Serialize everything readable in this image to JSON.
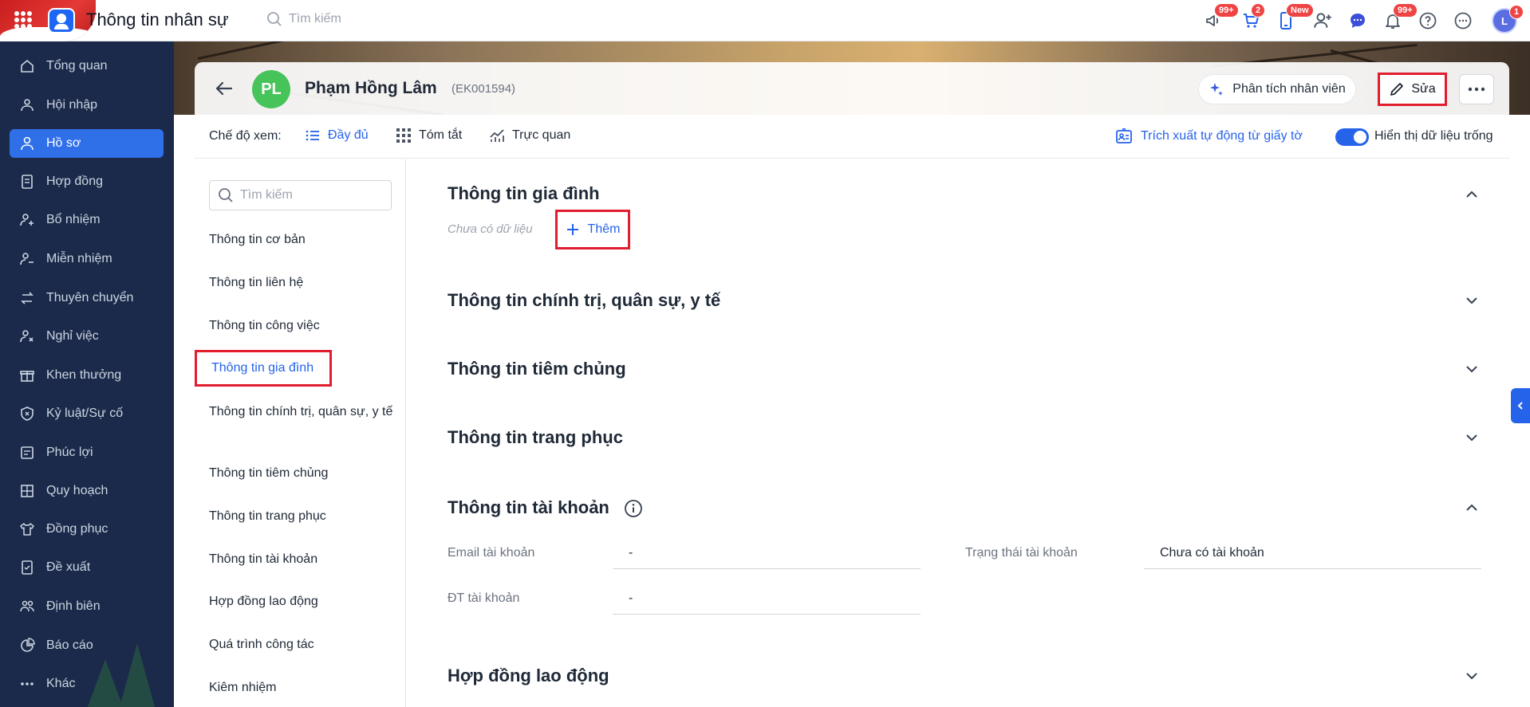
{
  "app": {
    "title": "Thông tin nhân sự",
    "search_placeholder": "Tìm kiếm"
  },
  "top_icons": [
    {
      "icon": "megaphone-icon",
      "badge": "99+"
    },
    {
      "icon": "cart-icon",
      "badge": "2"
    },
    {
      "icon": "phone-icon",
      "badge": "New"
    },
    {
      "icon": "add-user-icon",
      "badge": ""
    },
    {
      "icon": "chat-icon",
      "badge": ""
    },
    {
      "icon": "bell-icon",
      "badge": "99+"
    },
    {
      "icon": "help-icon",
      "badge": ""
    },
    {
      "icon": "more-circle-icon",
      "badge": ""
    }
  ],
  "user": {
    "initials": "L",
    "badge": "1"
  },
  "sidebar": {
    "items": [
      {
        "label": "Tổng quan",
        "icon": "home-icon"
      },
      {
        "label": "Hội nhập",
        "icon": "onboard-icon"
      },
      {
        "label": "Hồ sơ",
        "icon": "profile-icon",
        "active": true
      },
      {
        "label": "Hợp đồng",
        "icon": "contract-icon"
      },
      {
        "label": "Bổ nhiệm",
        "icon": "appoint-icon"
      },
      {
        "label": "Miễn nhiệm",
        "icon": "dismiss-icon"
      },
      {
        "label": "Thuyên chuyển",
        "icon": "transfer-icon"
      },
      {
        "label": "Nghỉ việc",
        "icon": "resign-icon"
      },
      {
        "label": "Khen thưởng",
        "icon": "reward-icon"
      },
      {
        "label": "Kỷ luật/Sự cố",
        "icon": "discipline-icon"
      },
      {
        "label": "Phúc lợi",
        "icon": "benefit-icon"
      },
      {
        "label": "Quy hoạch",
        "icon": "plan-icon"
      },
      {
        "label": "Đồng phục",
        "icon": "uniform-icon"
      },
      {
        "label": "Đề xuất",
        "icon": "propose-icon"
      },
      {
        "label": "Định biên",
        "icon": "headcount-icon"
      },
      {
        "label": "Báo cáo",
        "icon": "report-icon"
      },
      {
        "label": "Khác",
        "icon": "other-icon"
      }
    ]
  },
  "employee": {
    "initials": "PL",
    "name": "Phạm Hồng Lâm",
    "code": "(EK001594)",
    "analyze_label": "Phân tích nhân viên",
    "edit_label": "Sửa"
  },
  "viewbar": {
    "label": "Chế độ xem:",
    "options": [
      {
        "label": "Đầy đủ",
        "icon": "list-icon",
        "active": true
      },
      {
        "label": "Tóm tắt",
        "icon": "grid-dots-icon"
      },
      {
        "label": "Trực quan",
        "icon": "trend-chart-icon"
      }
    ],
    "extract_label": "Trích xuất tự động từ giấy tờ",
    "toggle_label": "Hiển thị dữ liệu trống",
    "toggle_on": true
  },
  "section_nav": {
    "search_placeholder": "Tìm kiếm",
    "items": [
      "Thông tin cơ bản",
      "Thông tin liên hệ",
      "Thông tin công việc",
      "Thông tin gia đình",
      "Thông tin chính trị, quân sự, y tế",
      "Thông tin tiêm chủng",
      "Thông tin trang phục",
      "Thông tin tài khoản",
      "Hợp đồng lao động",
      "Quá trình công tác",
      "Kiêm nhiệm"
    ],
    "active_index": 3
  },
  "content": {
    "family": {
      "title": "Thông tin gia đình",
      "empty": "Chưa có dữ liệu",
      "add_label": "Thêm"
    },
    "political": {
      "title": "Thông tin chính trị, quân sự, y tế"
    },
    "vaccination": {
      "title": "Thông tin tiêm chủng"
    },
    "uniform": {
      "title": "Thông tin trang phục"
    },
    "account": {
      "title": "Thông tin tài khoản",
      "email_label": "Email tài khoản",
      "email_value": "-",
      "status_label": "Trạng thái tài khoản",
      "status_value": "Chưa có tài khoản",
      "phone_label": "ĐT tài khoản",
      "phone_value": "-"
    },
    "labor_contract": {
      "title": "Hợp đồng lao động"
    }
  }
}
